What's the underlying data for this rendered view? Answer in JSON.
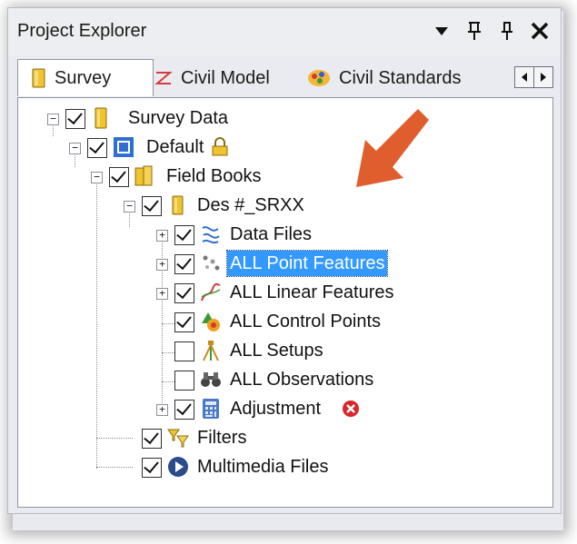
{
  "window": {
    "title": "Project Explorer"
  },
  "tabs": [
    {
      "label": "Survey",
      "icon": "folder-icon"
    },
    {
      "label": "Civil Model",
      "icon": "civil-model-icon"
    },
    {
      "label": "Civil Standards",
      "icon": "civil-standards-icon"
    }
  ],
  "tree": {
    "survey_data": "Survey Data",
    "default": "Default",
    "field_books": "Field Books",
    "des_srxx": "Des #_SRXX",
    "data_files": "Data Files",
    "all_point_features": "ALL Point Features",
    "all_linear_features": "ALL Linear Features",
    "all_control_points": "ALL Control Points",
    "all_setups": "ALL Setups",
    "all_observations": "ALL Observations",
    "adjustment": "Adjustment",
    "filters": "Filters",
    "multimedia_files": "Multimedia Files"
  },
  "selected_item": "ALL Point Features",
  "colors": {
    "selection": "#3399ff",
    "annotation_arrow": "#e05d2e",
    "error_badge": "#d9262c"
  }
}
